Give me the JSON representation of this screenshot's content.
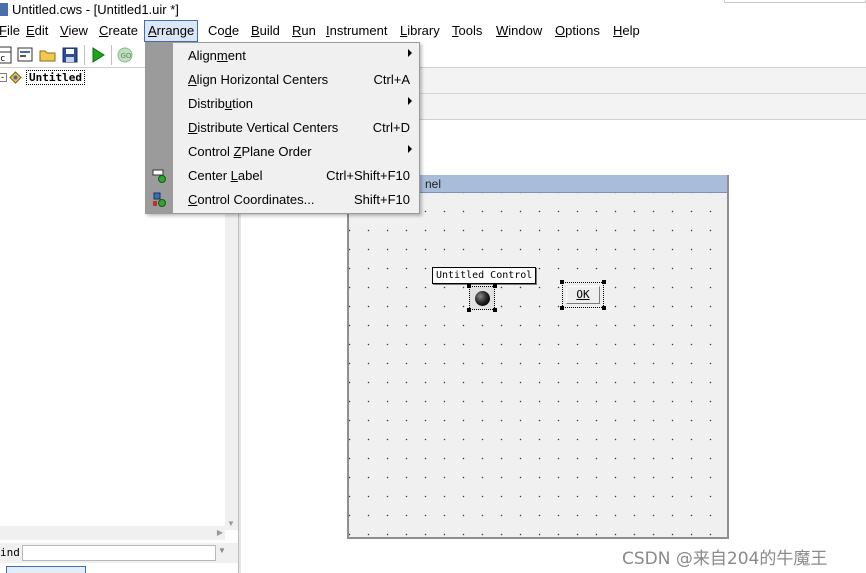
{
  "window": {
    "title": "Untitled.cws - [Untitled1.uir *]"
  },
  "menubar": {
    "items": [
      {
        "label": "File",
        "mnemonic_index": 0
      },
      {
        "label": "Edit",
        "mnemonic_index": 0
      },
      {
        "label": "View",
        "mnemonic_index": 0
      },
      {
        "label": "Create",
        "mnemonic_index": 0
      },
      {
        "label": "Arrange",
        "mnemonic_index": 0,
        "active": true
      },
      {
        "label": "Code",
        "mnemonic_index": 2
      },
      {
        "label": "Build",
        "mnemonic_index": 0
      },
      {
        "label": "Run",
        "mnemonic_index": 0
      },
      {
        "label": "Instrument",
        "mnemonic_index": 0
      },
      {
        "label": "Library",
        "mnemonic_index": 0
      },
      {
        "label": "Tools",
        "mnemonic_index": 0
      },
      {
        "label": "Window",
        "mnemonic_index": 0
      },
      {
        "label": "Options",
        "mnemonic_index": 0
      },
      {
        "label": "Help",
        "mnemonic_index": 0
      }
    ]
  },
  "toolbar": {
    "buttons": [
      {
        "name": "new-file-icon"
      },
      {
        "name": "open-project-icon"
      },
      {
        "name": "open-folder-icon"
      },
      {
        "name": "save-icon"
      },
      {
        "name": "run-icon"
      },
      {
        "name": "debug-icon"
      }
    ]
  },
  "tree": {
    "root_label": "Untitled",
    "expander": "-"
  },
  "find": {
    "label": "ind",
    "value": ""
  },
  "arrange_menu": {
    "items": [
      {
        "label": "Alignment",
        "mnemonic_index": 5,
        "shortcut": "",
        "submenu": true,
        "icon": ""
      },
      {
        "label": "Align Horizontal Centers",
        "mnemonic_index": 0,
        "shortcut": "Ctrl+A",
        "submenu": false,
        "icon": ""
      },
      {
        "label": "Distribution",
        "mnemonic_index": 7,
        "shortcut": "",
        "submenu": true,
        "icon": ""
      },
      {
        "label": "Distribute Vertical Centers",
        "mnemonic_index": 0,
        "shortcut": "Ctrl+D",
        "submenu": false,
        "icon": ""
      },
      {
        "label": "Control ZPlane Order",
        "mnemonic_index": 8,
        "shortcut": "",
        "submenu": true,
        "icon": ""
      },
      {
        "label": "Center Label",
        "mnemonic_index": 7,
        "shortcut": "Ctrl+Shift+F10",
        "submenu": false,
        "icon": "center-label-icon"
      },
      {
        "label": "Control Coordinates...",
        "mnemonic_index": 0,
        "shortcut": "Shift+F10",
        "submenu": false,
        "icon": "control-coordinates-icon"
      }
    ]
  },
  "panel": {
    "title_visible": "nel",
    "led_label": "Untitled Control",
    "ok_label": "OK"
  },
  "watermark": "CSDN @来自204的牛魔王",
  "colors": {
    "menu_active_outline": "#3c6fb4",
    "panel_titlebar": "#a9bddb",
    "menu_gutter": "#9b9b9b",
    "run_green": "#1aa51a"
  }
}
